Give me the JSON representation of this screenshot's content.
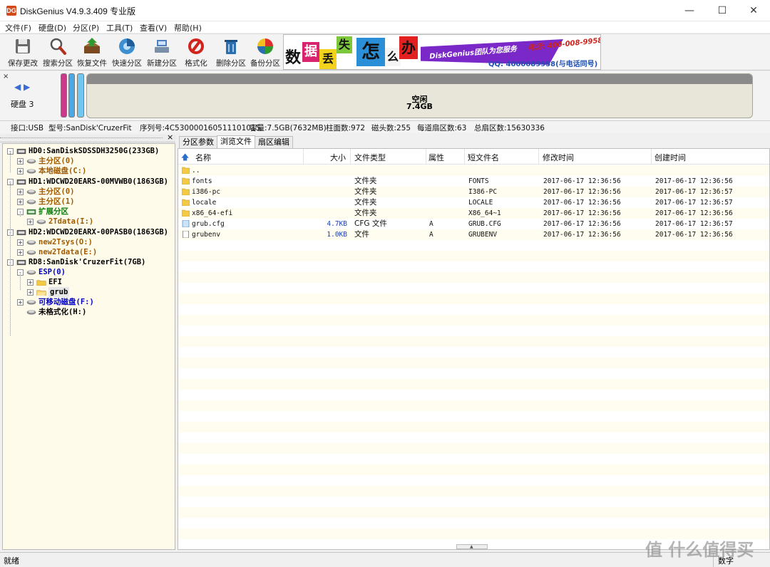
{
  "window": {
    "app_icon": "DG",
    "title": "DiskGenius V4.9.3.409 专业版",
    "minimize": "—",
    "maximize": "☐",
    "close": "✕"
  },
  "menu": [
    "文件(F)",
    "硬盘(D)",
    "分区(P)",
    "工具(T)",
    "查看(V)",
    "帮助(H)"
  ],
  "toolbar": [
    {
      "label": "保存更改",
      "icon": "floppy-disk-icon"
    },
    {
      "label": "搜索分区",
      "icon": "magnifier-icon"
    },
    {
      "label": "恢复文件",
      "icon": "recover-box-icon"
    },
    {
      "label": "快速分区",
      "icon": "quick-partition-icon"
    },
    {
      "label": "新建分区",
      "icon": "new-partition-icon"
    },
    {
      "label": "格式化",
      "icon": "format-icon"
    },
    {
      "label": "删除分区",
      "icon": "trash-icon"
    },
    {
      "label": "备份分区",
      "icon": "backup-pie-icon"
    }
  ],
  "banner": {
    "chars": [
      "数",
      "据",
      "丢",
      "失",
      "怎",
      "么",
      "办"
    ],
    "brand": "DiskGenius团队为您服务",
    "phone": "电话: 400-008-9958",
    "qq": "QQ: 4000089958(与电话同号)"
  },
  "disk_map": {
    "disk_label": "硬盘 3",
    "free_label": "空闲",
    "free_size": "7.4GB"
  },
  "disk_info": {
    "interface": "接口:USB",
    "model": "型号:SanDisk'CruzerFit",
    "serial": "序列号:4C530000160511101015",
    "capacity": "容量:7.5GB(7632MB)",
    "cylinders": "柱面数:972",
    "heads": "磁头数:255",
    "sectors_per_track": "每道扇区数:63",
    "total_sectors": "总扇区数:15630336"
  },
  "tree": {
    "close": "×",
    "nodes": [
      {
        "label": "HD0:SanDiskSDSSDH3250G(233GB)",
        "color": "#000000"
      },
      {
        "label": "主分区(0)",
        "color": "#a05a00"
      },
      {
        "label": "本地磁盘(C:)",
        "color": "#a05a00"
      },
      {
        "label": "HD1:WDCWD20EARS-00MVWB0(1863GB)",
        "color": "#000000"
      },
      {
        "label": "主分区(0)",
        "color": "#a05a00"
      },
      {
        "label": "主分区(1)",
        "color": "#a05a00"
      },
      {
        "label": "扩展分区",
        "color": "#0a7a0a"
      },
      {
        "label": "2Tdata(I:)",
        "color": "#a05a00"
      },
      {
        "label": "HD2:WDCWD20EARX-00PASB0(1863GB)",
        "color": "#000000"
      },
      {
        "label": "new2Tsys(O:)",
        "color": "#a05a00"
      },
      {
        "label": "new2Tdata(E:)",
        "color": "#a05a00"
      },
      {
        "label": "RD8:SanDisk'CruzerFit(7GB)",
        "color": "#000000"
      },
      {
        "label": "ESP(0)",
        "color": "#0000c0"
      },
      {
        "label": "EFI",
        "color": "#000000"
      },
      {
        "label": "grub",
        "color": "#000000"
      },
      {
        "label": "可移动磁盘(F:)",
        "color": "#0000c0"
      },
      {
        "label": "未格式化(H:)",
        "color": "#000000"
      }
    ]
  },
  "tabs": [
    "分区参数",
    "浏览文件",
    "扇区编辑"
  ],
  "columns": [
    "名称",
    "大小",
    "文件类型",
    "属性",
    "短文件名",
    "修改时间",
    "创建时间"
  ],
  "files": [
    {
      "name": "..",
      "size": "",
      "type": "",
      "attr": "",
      "short": "",
      "mtime": "",
      "ctime": "",
      "icon": "folder-icon"
    },
    {
      "name": "fonts",
      "size": "",
      "type": "文件夹",
      "attr": "",
      "short": "FONTS",
      "mtime": "2017-06-17 12:36:56",
      "ctime": "2017-06-17 12:36:56",
      "icon": "folder-icon"
    },
    {
      "name": "i386-pc",
      "size": "",
      "type": "文件夹",
      "attr": "",
      "short": "I386-PC",
      "mtime": "2017-06-17 12:36:56",
      "ctime": "2017-06-17 12:36:57",
      "icon": "folder-icon"
    },
    {
      "name": "locale",
      "size": "",
      "type": "文件夹",
      "attr": "",
      "short": "LOCALE",
      "mtime": "2017-06-17 12:36:56",
      "ctime": "2017-06-17 12:36:57",
      "icon": "folder-icon"
    },
    {
      "name": "x86_64-efi",
      "size": "",
      "type": "文件夹",
      "attr": "",
      "short": "X86_64~1",
      "mtime": "2017-06-17 12:36:56",
      "ctime": "2017-06-17 12:36:56",
      "icon": "folder-icon"
    },
    {
      "name": "grub.cfg",
      "size": "4.7KB",
      "type": "CFG 文件",
      "attr": "A",
      "short": "GRUB.CFG",
      "mtime": "2017-06-17 12:36:56",
      "ctime": "2017-06-17 12:36:57",
      "icon": "cfg-file-icon"
    },
    {
      "name": "grubenv",
      "size": "1.0KB",
      "type": "文件",
      "attr": "A",
      "short": "GRUBENV",
      "mtime": "2017-06-17 12:36:56",
      "ctime": "2017-06-17 12:36:56",
      "icon": "file-icon"
    }
  ],
  "status": {
    "left": "就绪",
    "right": "数字"
  },
  "watermark": "值 什么值得买"
}
